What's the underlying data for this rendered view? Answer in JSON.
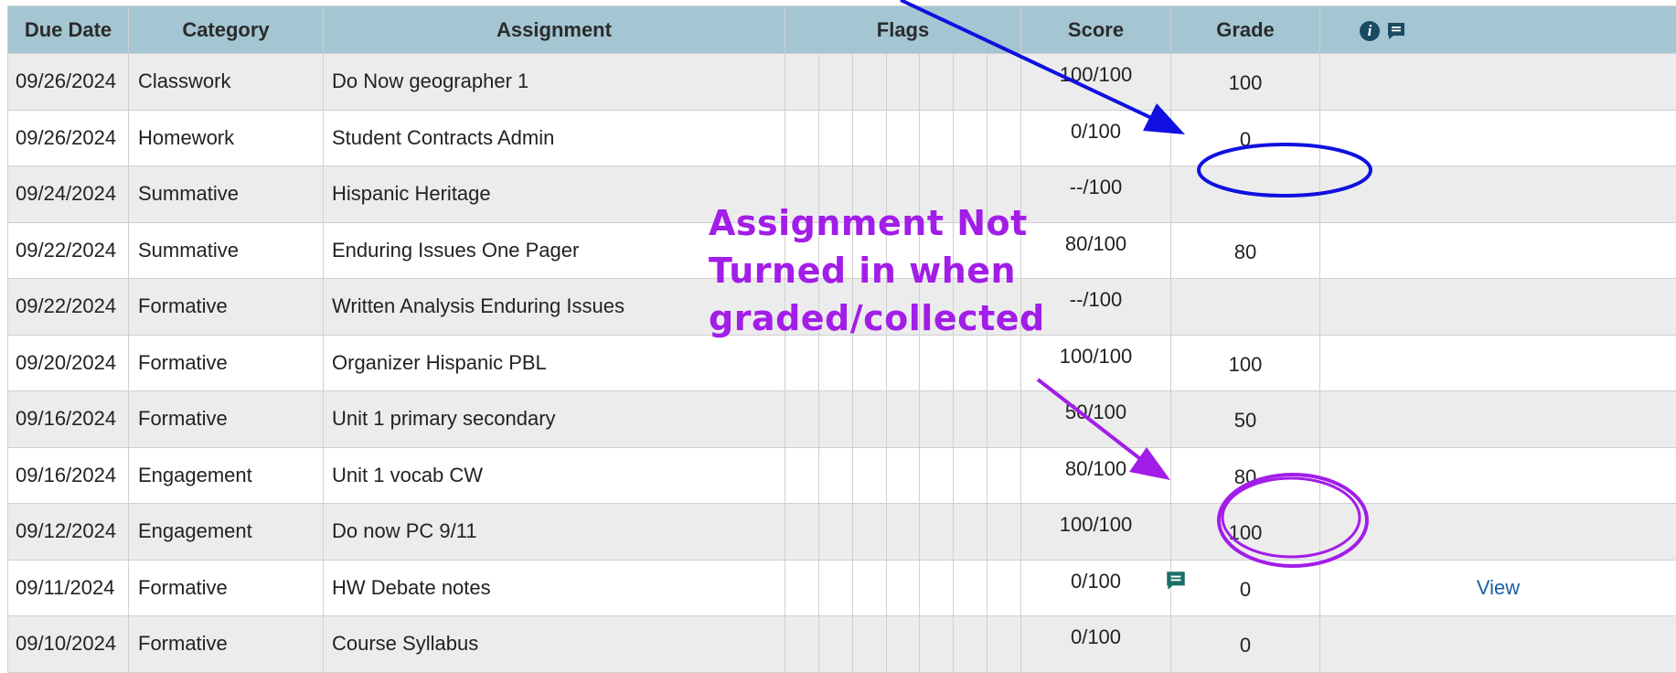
{
  "table": {
    "headers": {
      "due_date": "Due Date",
      "category": "Category",
      "assignment": "Assignment",
      "flags": "Flags",
      "score": "Score",
      "grade": "Grade"
    },
    "header_icons": [
      "info-icon",
      "comment-icon"
    ],
    "rows": [
      {
        "due": "09/26/2024",
        "category": "Classwork",
        "assignment": "Do Now geographer 1",
        "score": "100/100",
        "grade": "100",
        "action": ""
      },
      {
        "due": "09/26/2024",
        "category": "Homework",
        "assignment": "Student Contracts Admin",
        "score": "0/100",
        "grade": "0",
        "action": ""
      },
      {
        "due": "09/24/2024",
        "category": "Summative",
        "assignment": "Hispanic Heritage",
        "score": "--/100",
        "grade": "",
        "action": ""
      },
      {
        "due": "09/22/2024",
        "category": "Summative",
        "assignment": "Enduring Issues One Pager",
        "score": "80/100",
        "grade": "80",
        "action": ""
      },
      {
        "due": "09/22/2024",
        "category": "Formative",
        "assignment": "Written Analysis Enduring Issues",
        "score": "--/100",
        "grade": "",
        "action": ""
      },
      {
        "due": "09/20/2024",
        "category": "Formative",
        "assignment": "Organizer Hispanic PBL",
        "score": "100/100",
        "grade": "100",
        "action": ""
      },
      {
        "due": "09/16/2024",
        "category": "Formative",
        "assignment": "Unit 1 primary secondary",
        "score": "50/100",
        "grade": "50",
        "action": ""
      },
      {
        "due": "09/16/2024",
        "category": "Engagement",
        "assignment": "Unit 1 vocab CW",
        "score": "80/100",
        "grade": "80",
        "action": ""
      },
      {
        "due": "09/12/2024",
        "category": "Engagement",
        "assignment": "Do now PC 9/11",
        "score": "100/100",
        "grade": "100",
        "action": ""
      },
      {
        "due": "09/11/2024",
        "category": "Formative",
        "assignment": "HW Debate notes",
        "score": "0/100",
        "grade": "0",
        "action": "View",
        "has_comment": true
      },
      {
        "due": "09/10/2024",
        "category": "Formative",
        "assignment": "Course Syllabus",
        "score": "0/100",
        "grade": "0",
        "action": ""
      }
    ]
  },
  "annotation": {
    "lines": [
      "Assignment Not",
      "Turned in when",
      "graded/collected"
    ],
    "colors": {
      "blue": "#1010e0",
      "purple": "#a21de8"
    }
  },
  "colors": {
    "header_bg": "#a4c6d2",
    "row_alt_bg": "#ececec",
    "link": "#1a5fa5"
  }
}
